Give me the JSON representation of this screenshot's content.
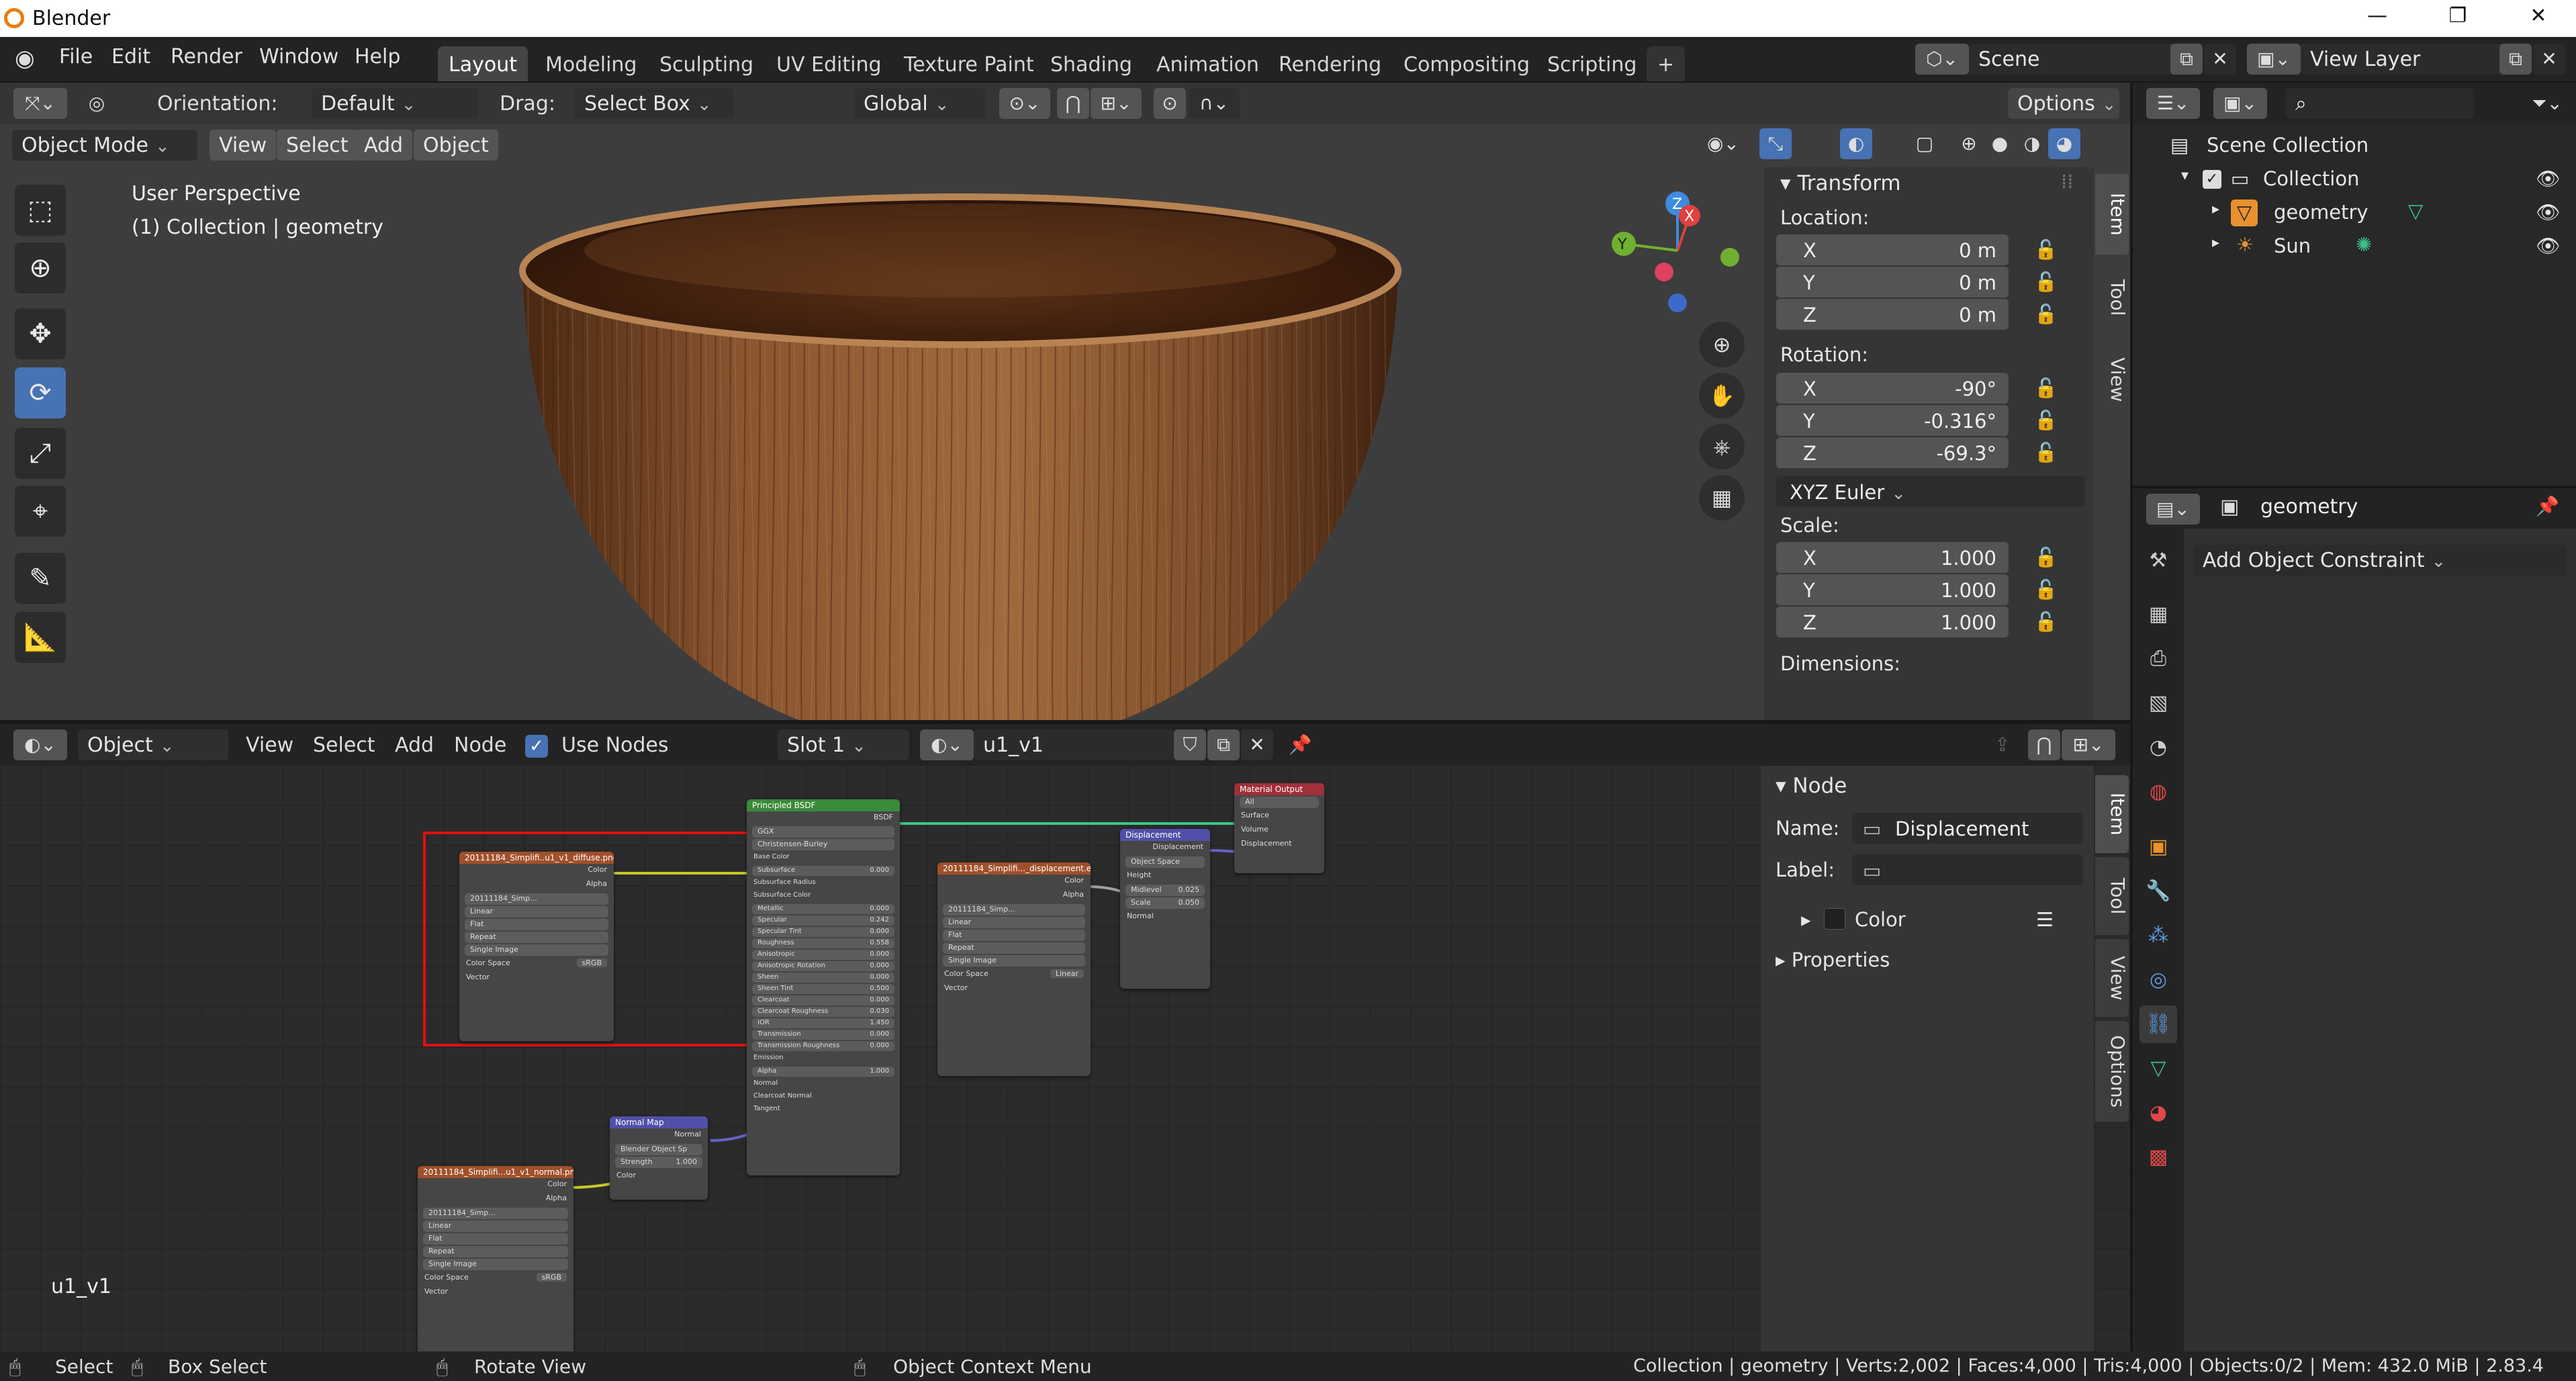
{
  "os_window": {
    "title": "Blender",
    "minimize": "—",
    "maximize": "❐",
    "close": "✕"
  },
  "menu": [
    "File",
    "Edit",
    "Render",
    "Window",
    "Help"
  ],
  "workspaces": [
    "Layout",
    "Modeling",
    "Sculpting",
    "UV Editing",
    "Texture Paint",
    "Shading",
    "Animation",
    "Rendering",
    "Compositing",
    "Scripting",
    "+"
  ],
  "active_workspace": "Layout",
  "scene": {
    "name": "Scene"
  },
  "view_layer": {
    "name": "View Layer"
  },
  "viewport": {
    "orientation_label": "Orientation:",
    "orientation_value": "Default",
    "drag_label": "Drag:",
    "drag_value": "Select Box",
    "transform_orientation": "Global",
    "options": "Options",
    "mode": "Object Mode",
    "header_menus": [
      "View",
      "Select",
      "Add",
      "Object"
    ],
    "overlay_line1": "User Perspective",
    "overlay_line2": "(1) Collection | geometry",
    "gizmo": {
      "z": "Z",
      "x": "X",
      "y": "Y"
    },
    "tools": [
      "select-box-icon",
      "cursor-icon",
      "move-icon",
      "rotate-icon",
      "scale-icon",
      "transform-icon",
      "annotate-icon",
      "measure-icon"
    ]
  },
  "npanel": {
    "section": "Transform",
    "location_label": "Location:",
    "location": [
      {
        "axis": "X",
        "value": "0 m"
      },
      {
        "axis": "Y",
        "value": "0 m"
      },
      {
        "axis": "Z",
        "value": "0 m"
      }
    ],
    "rotation_label": "Rotation:",
    "rotation": [
      {
        "axis": "X",
        "value": "-90°"
      },
      {
        "axis": "Y",
        "value": "-0.316°"
      },
      {
        "axis": "Z",
        "value": "-69.3°"
      }
    ],
    "rotation_mode": "XYZ Euler",
    "scale_label": "Scale:",
    "scale": [
      {
        "axis": "X",
        "value": "1.000"
      },
      {
        "axis": "Y",
        "value": "1.000"
      },
      {
        "axis": "Z",
        "value": "1.000"
      }
    ],
    "dimensions_label": "Dimensions:",
    "tabs": [
      "Item",
      "Tool",
      "View"
    ]
  },
  "node_editor": {
    "editor_type": "Object",
    "menus": [
      "View",
      "Select",
      "Add",
      "Node"
    ],
    "use_nodes_label": "Use Nodes",
    "use_nodes_checked": true,
    "slot": "Slot 1",
    "material": "u1_v1",
    "corner_label": "u1_v1",
    "node_panel": {
      "section": "Node",
      "name_label": "Name:",
      "name_value": "Displacement",
      "label_label": "Label:",
      "label_value": "",
      "color_label": "Color",
      "properties_label": "Properties",
      "tabs": [
        "Item",
        "Tool",
        "View",
        "Options"
      ]
    },
    "nodes": {
      "diffuse": {
        "title": "20111184_Simplifi..u1_v1_diffuse.png",
        "out1": "Color",
        "out2": "Alpha",
        "image": "20111184_Simp...",
        "f1": "Linear",
        "f2": "Flat",
        "f3": "Repeat",
        "f4": "Single Image",
        "cs_label": "Color Space",
        "cs_value": "sRGB",
        "in1": "Vector"
      },
      "bsdf": {
        "title": "Principled BSDF",
        "out": "BSDF",
        "dist": "GGX",
        "ss_method": "Christensen-Burley",
        "rows": [
          {
            "n": "Base Color",
            "v": ""
          },
          {
            "n": "Subsurface",
            "v": "0.000"
          },
          {
            "n": "Subsurface Radius",
            "v": ""
          },
          {
            "n": "Subsurface Color",
            "v": ""
          },
          {
            "n": "Metallic",
            "v": "0.000"
          },
          {
            "n": "Specular",
            "v": "0.242"
          },
          {
            "n": "Specular Tint",
            "v": "0.000"
          },
          {
            "n": "Roughness",
            "v": "0.558"
          },
          {
            "n": "Anisotropic",
            "v": "0.000"
          },
          {
            "n": "Anisotropic Rotation",
            "v": "0.000"
          },
          {
            "n": "Sheen",
            "v": "0.000"
          },
          {
            "n": "Sheen Tint",
            "v": "0.500"
          },
          {
            "n": "Clearcoat",
            "v": "0.000"
          },
          {
            "n": "Clearcoat Roughness",
            "v": "0.030"
          },
          {
            "n": "IOR",
            "v": "1.450"
          },
          {
            "n": "Transmission",
            "v": "0.000"
          },
          {
            "n": "Transmission Roughness",
            "v": "0.000"
          },
          {
            "n": "Emission",
            "v": ""
          },
          {
            "n": "Alpha",
            "v": "1.000"
          },
          {
            "n": "Normal",
            "v": ""
          },
          {
            "n": "Clearcoat Normal",
            "v": ""
          },
          {
            "n": "Tangent",
            "v": ""
          }
        ]
      },
      "displacement_tex": {
        "title": "20111184_Simplifi..._displacement.ex",
        "out1": "Color",
        "out2": "Alpha",
        "image": "20111184_Simp...",
        "f1": "Linear",
        "f2": "Flat",
        "f3": "Repeat",
        "f4": "Single Image",
        "cs_label": "Color Space",
        "cs_value": "Linear",
        "in1": "Vector"
      },
      "displacement": {
        "title": "Displacement",
        "out": "Displacement",
        "space": "Object Space",
        "height": "Height",
        "midlevel_label": "Midlevel",
        "midlevel": "0.025",
        "scale_label": "Scale",
        "scale": "0.050",
        "normal": "Normal"
      },
      "output": {
        "title": "Material Output",
        "target": "All",
        "in1": "Surface",
        "in2": "Volume",
        "in3": "Displacement"
      },
      "normal_map": {
        "title": "Normal Map",
        "out": "Normal",
        "space": "Blender Object Sp",
        "strength_label": "Strength",
        "strength": "1.000",
        "in1": "Color"
      },
      "normal_tex": {
        "title": "20111184_Simplifi...u1_v1_normal.png",
        "out1": "Color",
        "out2": "Alpha",
        "image": "20111184_Simp...",
        "f1": "Linear",
        "f2": "Flat",
        "f3": "Repeat",
        "f4": "Single Image",
        "cs_label": "Color Space",
        "cs_value": "sRGB",
        "in1": "Vector"
      }
    }
  },
  "outliner": {
    "root": "Scene Collection",
    "collection": "Collection",
    "items": [
      "geometry",
      "Sun"
    ]
  },
  "properties": {
    "object_name": "geometry",
    "add_constraint": "Add Object Constraint"
  },
  "status_bar": {
    "select": "Select",
    "box_select": "Box Select",
    "rotate_view": "Rotate View",
    "context_menu": "Object Context Menu",
    "stats": "Collection | geometry | Verts:2,002 | Faces:4,000 | Tris:4,000 | Objects:0/2 | Mem: 432.0 MiB | 2.83.4"
  },
  "colors": {
    "accent": "#4772b3",
    "bsdf_header": "#3a8a3a",
    "texture_header": "#a0502a",
    "vector_header": "#5050a8",
    "output_header": "#a0303a",
    "selection_frame": "#e01010"
  }
}
